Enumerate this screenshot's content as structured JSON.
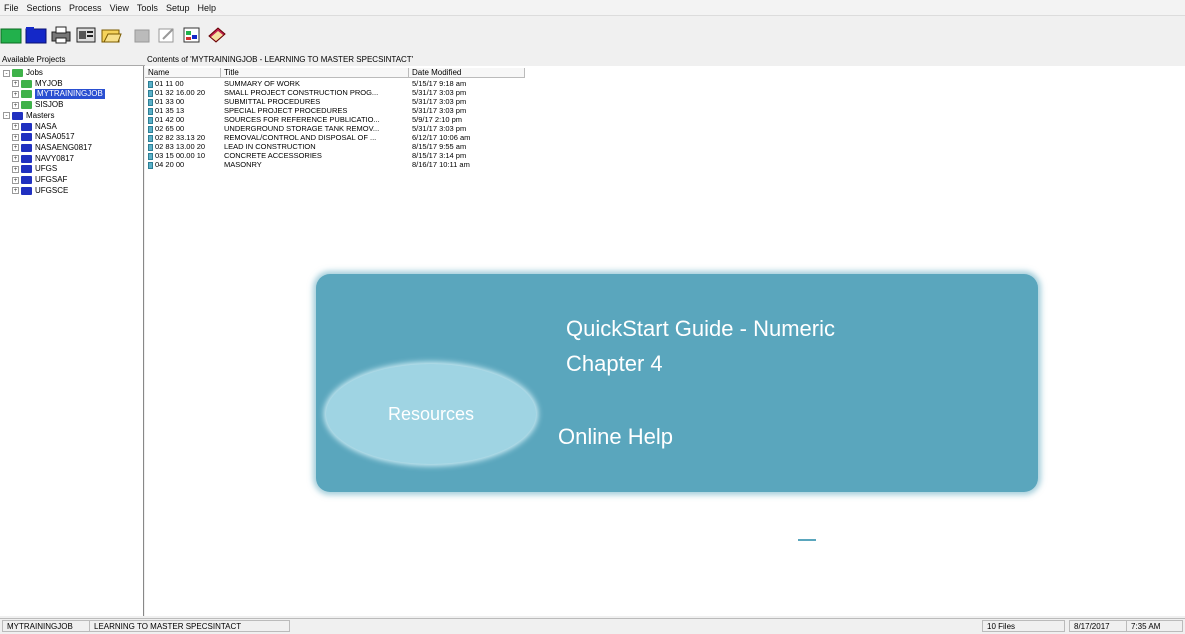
{
  "menu": [
    "File",
    "Sections",
    "Process",
    "View",
    "Tools",
    "Setup",
    "Help"
  ],
  "left": {
    "header": "Available Projects",
    "tree": [
      {
        "label": "Jobs",
        "level": 0,
        "color": "#3fb24a",
        "expanded": true
      },
      {
        "label": "MYJOB",
        "level": 1,
        "color": "#3fb24a"
      },
      {
        "label": "MYTRAININGJOB",
        "level": 1,
        "color": "#3fb24a",
        "selected": true
      },
      {
        "label": "SISJOB",
        "level": 1,
        "color": "#3fb24a"
      },
      {
        "label": "Masters",
        "level": 0,
        "color": "#2030c0",
        "expanded": true
      },
      {
        "label": "NASA",
        "level": 1,
        "color": "#2030c0"
      },
      {
        "label": "NASA0517",
        "level": 1,
        "color": "#2030c0"
      },
      {
        "label": "NASAENG0817",
        "level": 1,
        "color": "#2030c0"
      },
      {
        "label": "NAVY0817",
        "level": 1,
        "color": "#2030c0"
      },
      {
        "label": "UFGS",
        "level": 1,
        "color": "#2030c0"
      },
      {
        "label": "UFGSAF",
        "level": 1,
        "color": "#2030c0"
      },
      {
        "label": "UFGSCE",
        "level": 1,
        "color": "#2030c0"
      }
    ]
  },
  "right": {
    "header": "Contents of 'MYTRAININGJOB - LEARNING TO MASTER SPECSINTACT'",
    "columns": [
      "Name",
      "Title",
      "Date Modified"
    ],
    "rows": [
      [
        "01 11 00",
        "SUMMARY OF WORK",
        "5/15/17 9:18 am"
      ],
      [
        "01 32 16.00 20",
        "SMALL PROJECT CONSTRUCTION PROG...",
        "5/31/17 3:03 pm"
      ],
      [
        "01 33 00",
        "SUBMITTAL PROCEDURES",
        "5/31/17 3:03 pm"
      ],
      [
        "01 35 13",
        "SPECIAL PROJECT PROCEDURES",
        "5/31/17 3:03 pm"
      ],
      [
        "01 42 00",
        "SOURCES FOR REFERENCE PUBLICATIO...",
        "5/9/17 2:10 pm"
      ],
      [
        "02 65 00",
        "UNDERGROUND STORAGE TANK REMOV...",
        "5/31/17 3:03 pm"
      ],
      [
        "02 82 33.13 20",
        "REMOVAL/CONTROL AND DISPOSAL OF ...",
        "6/12/17 10:06 am"
      ],
      [
        "02 83 13.00 20",
        "LEAD IN CONSTRUCTION",
        "8/15/17 9:55 am"
      ],
      [
        "03 15 00.00 10",
        "CONCRETE ACCESSORIES",
        "8/15/17 3:14 pm"
      ],
      [
        "04 20 00",
        "MASONRY",
        "8/16/17 10:11 am"
      ]
    ]
  },
  "overlay": {
    "title": "QuickStart Guide - Numeric",
    "chapter": "Chapter 4",
    "resources": "Resources",
    "online_help": "Online Help"
  },
  "status": {
    "left": "MYTRAININGJOB",
    "mid": "LEARNING TO MASTER SPECSINTACT",
    "files": "10 Files",
    "date": "8/17/2017",
    "time": "7:35 AM"
  }
}
